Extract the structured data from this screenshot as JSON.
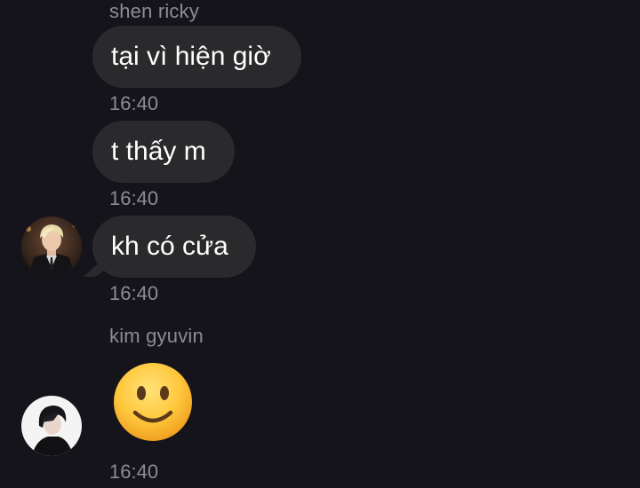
{
  "messages": [
    {
      "sender": "shen ricky",
      "text": "tại vì hiện giờ",
      "time": "16:40"
    },
    {
      "text": "t thấy m",
      "time": "16:40"
    },
    {
      "text": "kh có cửa",
      "time": "16:40"
    },
    {
      "sender": "kim gyuvin",
      "emoji": "slightly-smiling-face-icon",
      "time": "16:40"
    }
  ],
  "colors": {
    "background": "#16141b",
    "bubble": "#2a2a2c",
    "meta_text": "#8e8c93",
    "emoji_face": "#ffc83d"
  }
}
